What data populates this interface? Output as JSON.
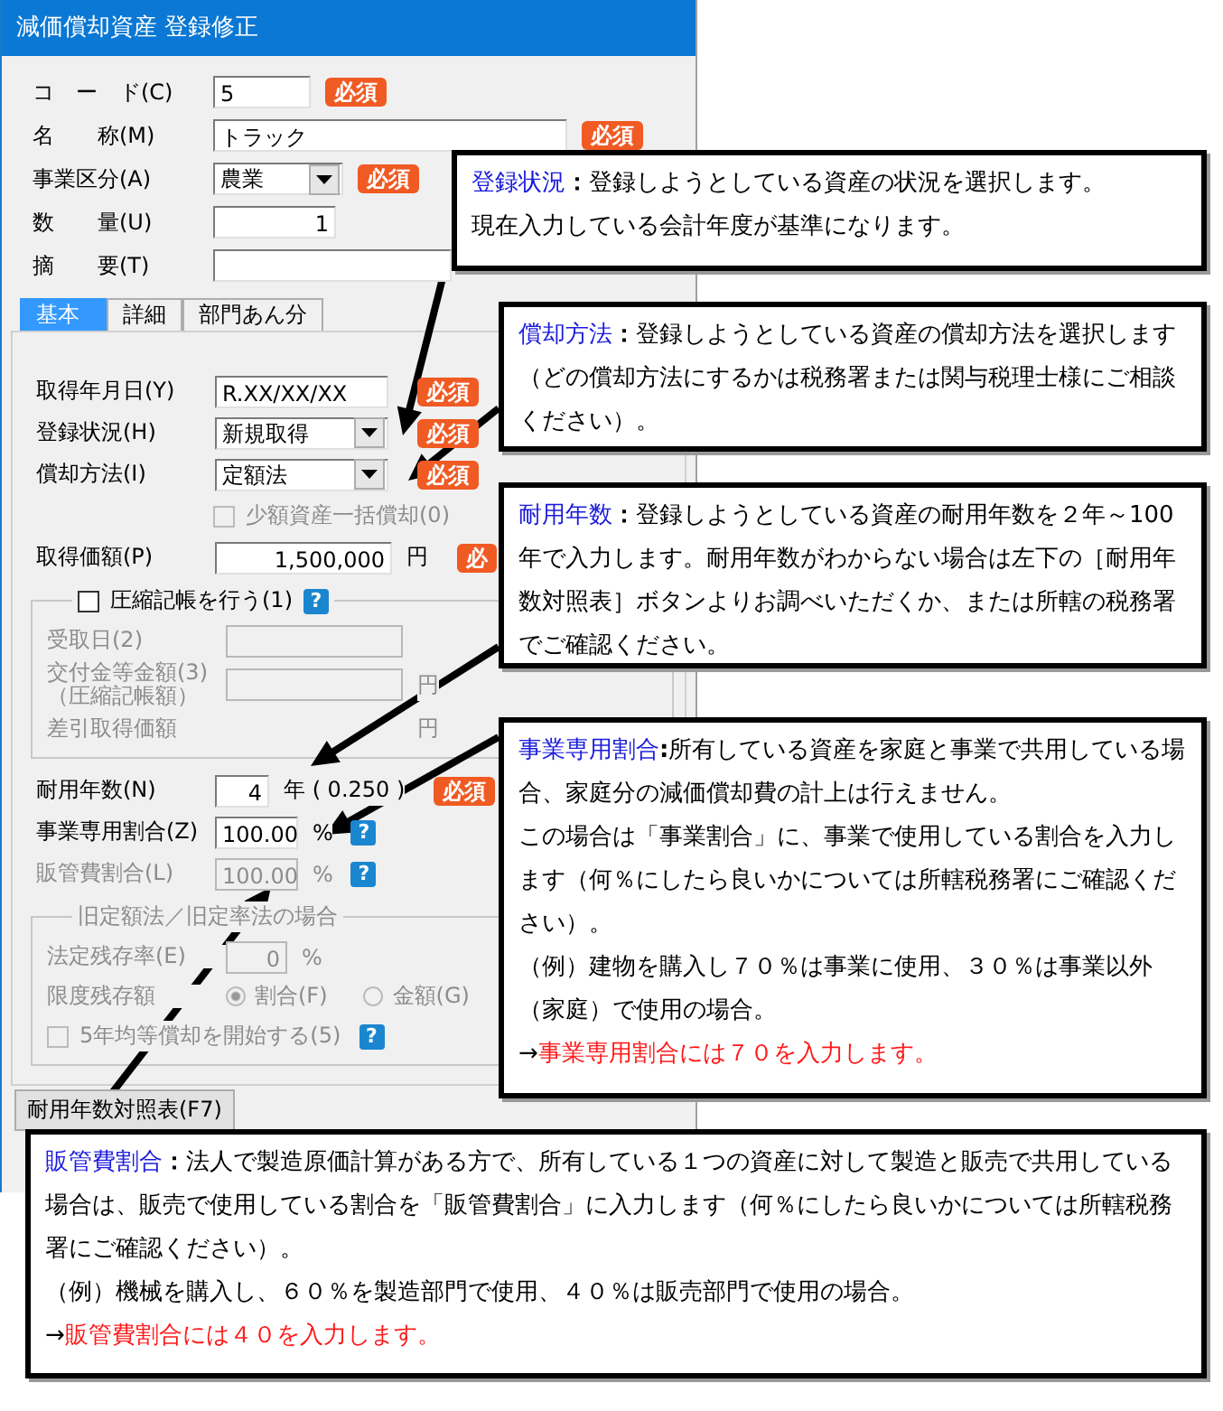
{
  "window": {
    "title": "減価償却資産 登録修正"
  },
  "header_rows": [
    {
      "kind": "code",
      "label": "コ　ー　ド(C)",
      "value": "5",
      "badge": "必須"
    },
    {
      "kind": "wide",
      "label": "名　　称(M)",
      "value": "トラック",
      "badge": "必須"
    },
    {
      "kind": "select",
      "label": "事業区分(A)",
      "value": "農業",
      "badge": "必須"
    },
    {
      "kind": "number",
      "label": "数　　量(U)",
      "value": "1"
    },
    {
      "kind": "memo",
      "label": "摘　　要(T)"
    }
  ],
  "tabs": [
    {
      "label": "基本",
      "selected": true
    },
    {
      "label": "詳細",
      "selected": false
    },
    {
      "label": "部門あん分",
      "selected": false
    }
  ],
  "panel_rows": [
    {
      "kind": "text",
      "label": "取得年月日(Y)",
      "value": "R.XX/XX/XX",
      "badge": "必須",
      "disabled": false
    },
    {
      "kind": "select",
      "label": "登録状況(H)",
      "value": "新規取得",
      "badge": "必須",
      "disabled": false
    },
    {
      "kind": "select",
      "label": "償却方法(I)",
      "value": "定額法",
      "badge": "必須",
      "disabled": false
    },
    {
      "kind": "check",
      "label": "少額資産一括償却(0)",
      "checked": false,
      "disabled": true
    },
    {
      "kind": "amount",
      "label": "取得価額(P)",
      "value": "1,500,000",
      "unit": "円",
      "badge": "必",
      "disabled": false
    },
    {
      "kind": "group",
      "title": "圧縮記帳を行う(1)",
      "checked": false,
      "help": "?",
      "rows": [
        {
          "kind": "field",
          "label": "受取日(2)",
          "disabled": true
        },
        {
          "kind": "field",
          "label": "交付金等金額(3)",
          "sublabel": "（圧縮記帳額）",
          "unit": "円",
          "disabled": true
        },
        {
          "kind": "readout",
          "label": "差引取得価額",
          "unit": "円",
          "disabled": true
        }
      ]
    },
    {
      "kind": "years",
      "label": "耐用年数(N)",
      "value": "4",
      "unit": "年 ( 0.250 )",
      "badge": "必須",
      "disabled": false
    },
    {
      "kind": "percent",
      "label": "事業専用割合(Z)",
      "value": "100.00",
      "unit": "%",
      "help": "?",
      "disabled": false
    },
    {
      "kind": "percent",
      "label": "販管費割合(L)",
      "value": "100.00",
      "unit": "%",
      "help": "?",
      "disabled": true
    },
    {
      "kind": "group",
      "title": "旧定額法／旧定率法の場合",
      "rows": [
        {
          "kind": "small",
          "label": "法定残存率(E)",
          "value": "0",
          "unit": "%",
          "disabled": true
        },
        {
          "kind": "radios",
          "label": "限度残存額",
          "disabled": true,
          "options": [
            {
              "label": "割合(F)",
              "selected": true
            },
            {
              "label": "金額(G)",
              "selected": false
            }
          ]
        },
        {
          "kind": "check",
          "label": "5年均等償却を開始する(5)",
          "checked": false,
          "help": "?",
          "disabled": true
        }
      ]
    }
  ],
  "bottom_button": "耐用年数対照表(F7)",
  "callouts": [
    {
      "term": "登録状況",
      "separator": "：",
      "lead": "登録しようとしている資産の状況を選択します。",
      "paragraphs": [
        "現在入力している会計年度が基準になります。"
      ]
    },
    {
      "term": "償却方法",
      "separator": "：",
      "lead": "登録しようとしている資産の償却方法を選択します（どの償却方法にするかは税務署または関与税理士様にご相談ください）。"
    },
    {
      "term": "耐用年数",
      "separator": "：",
      "lead": "登録しようとしている資産の耐用年数を２年～100 年で入力します。耐用年数がわからない場合は左下の［耐用年数対照表］ボタンよりお調べいただくか、または所轄の税務署でご確認ください。"
    },
    {
      "term": "事業専用割合",
      "separator": ":",
      "lead": "所有している資産を家庭と事業で共用している場合、家庭分の減価償却費の計上は行えません。",
      "paragraphs": [
        "この場合は「事業割合」に、事業で使用している割合を入力します（何％にしたら良いかについては所轄税務署にご確認ください）。",
        "（例）建物を購入し７０％は事業に使用、３０％は事業以外（家庭）で使用の場合。"
      ],
      "conclusion": {
        "arrow": "→",
        "text": "事業専用割合には７０を入力します。"
      }
    },
    {
      "term": "販管費割合",
      "separator": "：",
      "lead": "法人で製造原価計算がある方で、所有している１つの資産に対して製造と販売で共用している場合は、販売で使用している割合を「販管費割合」に入力します（何％にしたら良いかについては所轄税務署にご確認ください）。",
      "paragraphs": [
        "（例）機械を購入し、６０％を製造部門で使用、４０％は販売部門で使用の場合。"
      ],
      "conclusion": {
        "arrow": "→",
        "text": "販管費割合には４０を入力します。"
      }
    }
  ]
}
